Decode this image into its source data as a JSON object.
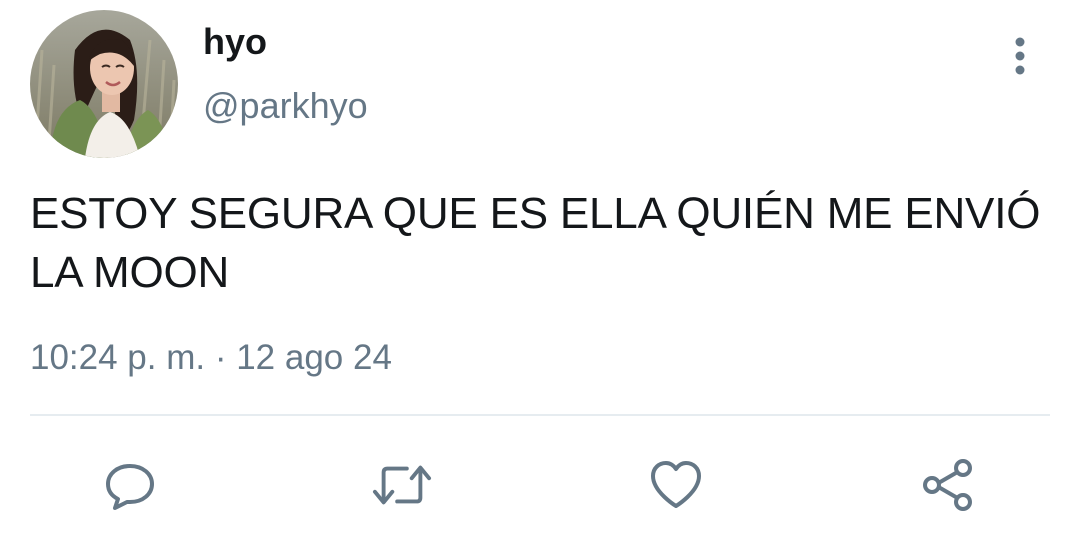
{
  "tweet": {
    "author": {
      "display_name": "hyo",
      "handle": "@parkhyo"
    },
    "text": "ESTOY SEGURA QUE ES ELLA QUIÉN ME ENVIÓ LA MOON",
    "timestamp": "10:24 p. m. · 12 ago 24"
  },
  "actions": [
    {
      "name": "reply",
      "icon": "comment-icon"
    },
    {
      "name": "retweet",
      "icon": "retweet-icon"
    },
    {
      "name": "like",
      "icon": "heart-icon"
    },
    {
      "name": "share",
      "icon": "share-icon"
    }
  ],
  "colors": {
    "icon": "#657786",
    "secondary_text": "#657786",
    "primary_text": "#14171a",
    "divider": "#e6ecf0"
  }
}
